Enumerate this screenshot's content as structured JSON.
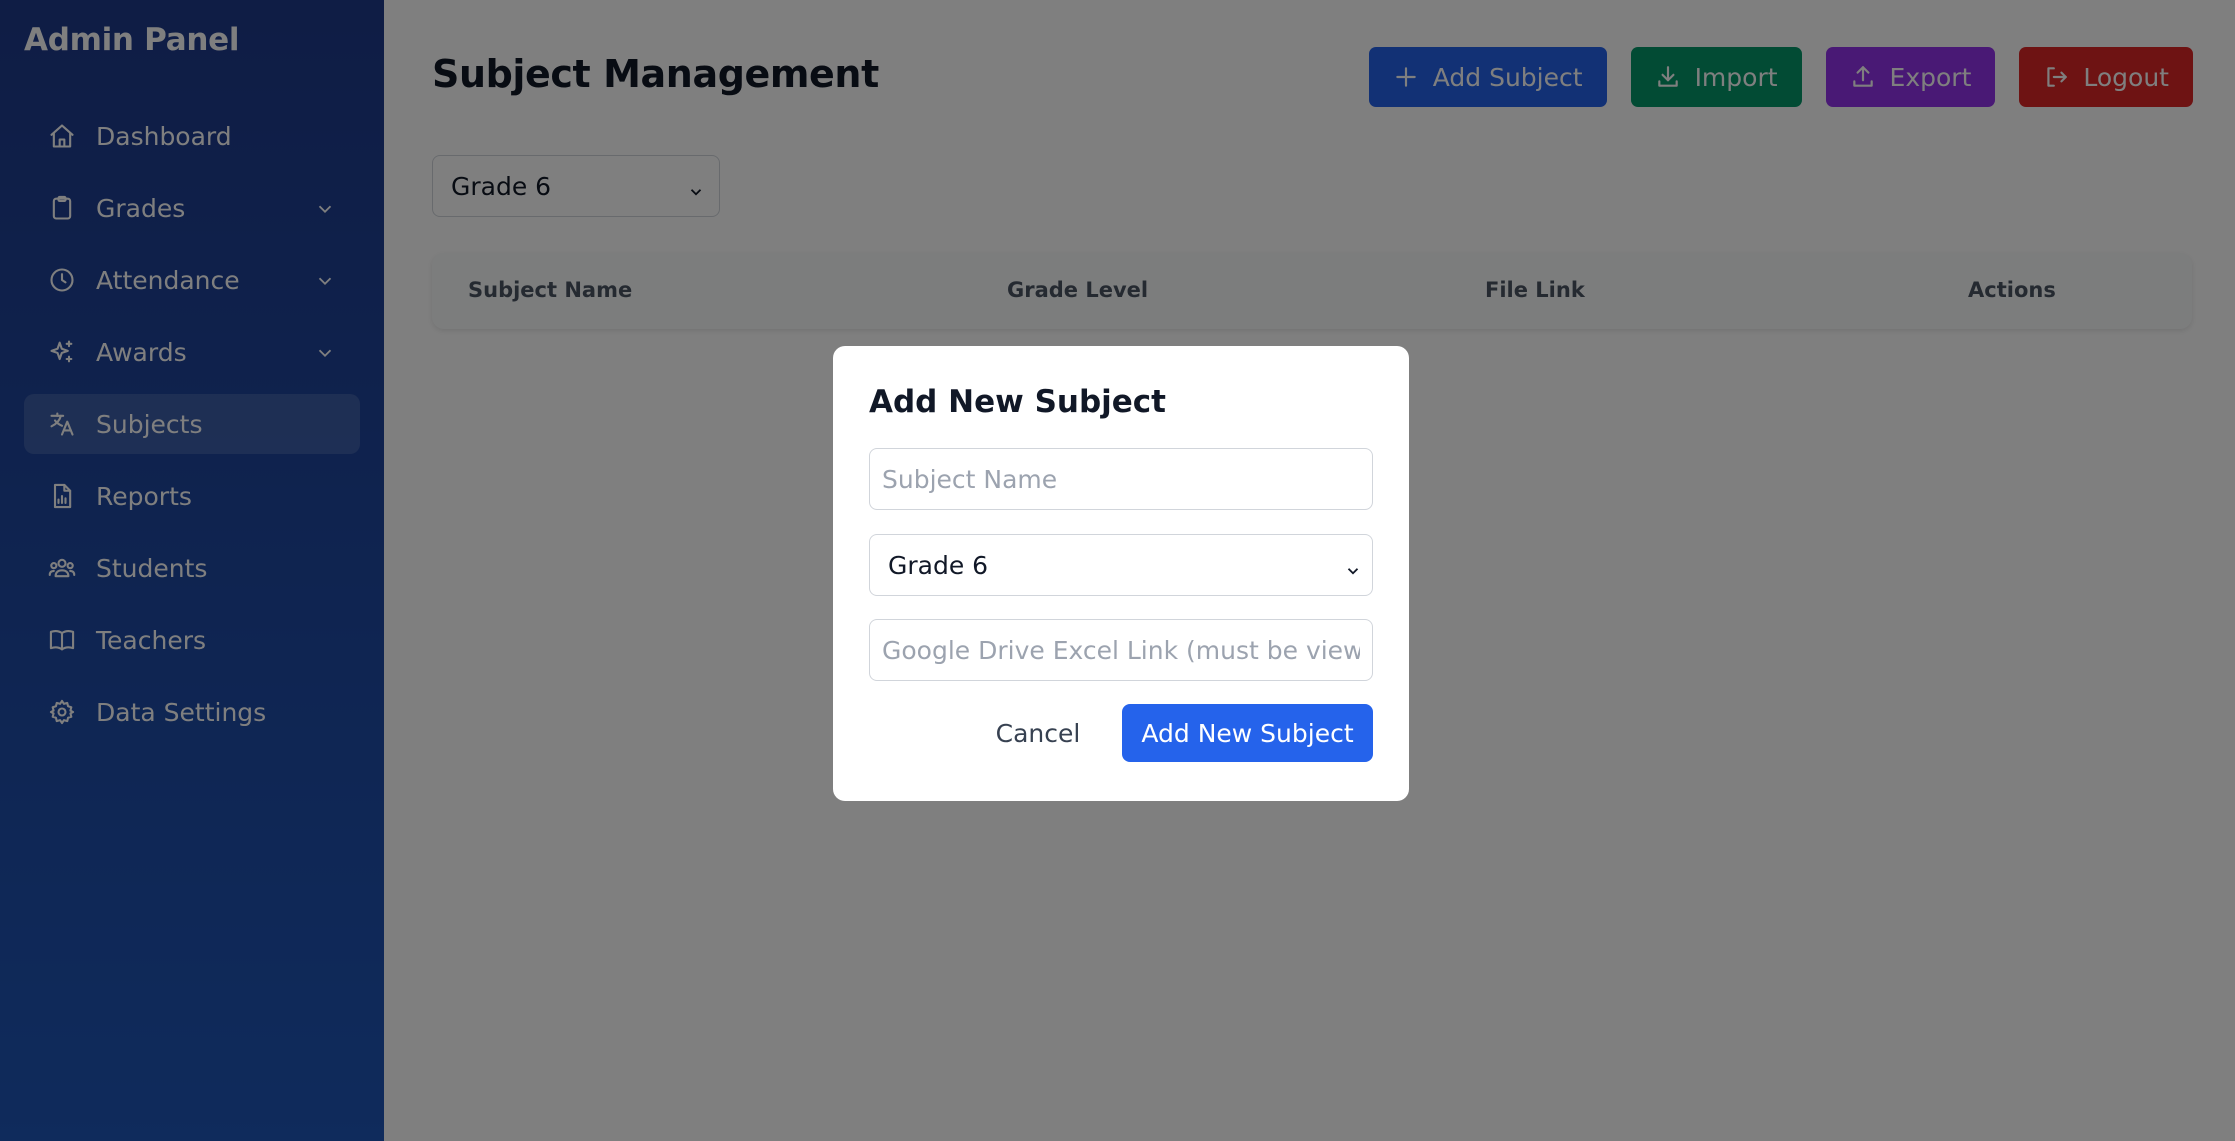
{
  "sidebar": {
    "brand": "Admin Panel",
    "items": [
      {
        "label": "Dashboard",
        "icon": "home-icon"
      },
      {
        "label": "Grades",
        "icon": "clipboard-icon",
        "expandable": true
      },
      {
        "label": "Attendance",
        "icon": "clock-icon",
        "expandable": true
      },
      {
        "label": "Awards",
        "icon": "sparkles-icon",
        "expandable": true
      },
      {
        "label": "Subjects",
        "icon": "translate-icon",
        "active": true
      },
      {
        "label": "Reports",
        "icon": "report-icon"
      },
      {
        "label": "Students",
        "icon": "users-icon"
      },
      {
        "label": "Teachers",
        "icon": "book-icon"
      },
      {
        "label": "Data Settings",
        "icon": "gear-icon"
      }
    ]
  },
  "header": {
    "title": "Subject Management",
    "buttons": {
      "add": "Add Subject",
      "import": "Import",
      "export": "Export",
      "logout": "Logout"
    }
  },
  "filter": {
    "grade_selected": "Grade 6"
  },
  "table": {
    "columns": [
      "Subject Name",
      "Grade Level",
      "File Link",
      "Actions"
    ],
    "rows": []
  },
  "modal": {
    "title": "Add New Subject",
    "subject_name_placeholder": "Subject Name",
    "subject_name_value": "",
    "grade_selected": "Grade 6",
    "link_placeholder": "Google Drive Excel Link (must be viewable)",
    "link_value": "",
    "cancel_label": "Cancel",
    "submit_label": "Add New Subject"
  },
  "colors": {
    "sidebar_top": "#1e3a8a",
    "sidebar_bottom": "#1e56b8",
    "add_button": "#2563eb",
    "import_button": "#059669",
    "export_button": "#9333ea",
    "logout_button": "#dc2626",
    "overlay": "rgba(0,0,0,0.5)"
  }
}
